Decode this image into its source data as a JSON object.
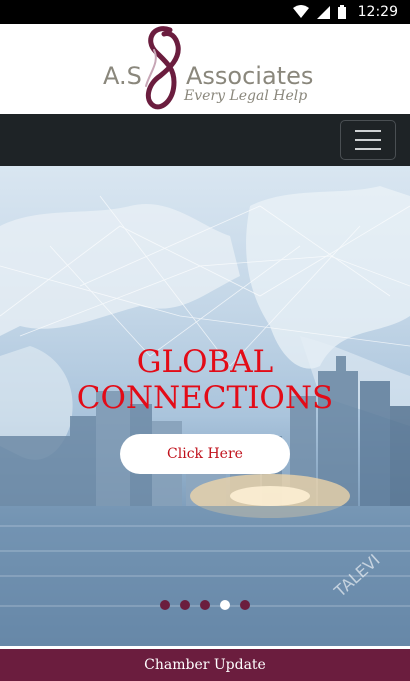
{
  "status_bar": {
    "time": "12:29",
    "icons": [
      "wifi-icon",
      "signal-icon",
      "battery-icon"
    ]
  },
  "header": {
    "logo_left": "A.S",
    "logo_right": "Associates",
    "logo_tagline": "Every Legal Help"
  },
  "navbar": {
    "toggle_icon": "hamburger-menu-icon"
  },
  "hero": {
    "title_line1": "GLOBAL",
    "title_line2": "CONNECTIONS",
    "button_label": "Click Here",
    "watermark": "TALEVI",
    "slides": [
      {
        "active": false
      },
      {
        "active": false
      },
      {
        "active": false
      },
      {
        "active": true
      },
      {
        "active": false
      }
    ]
  },
  "chamber_update": {
    "label": "Chamber Update"
  },
  "colors": {
    "brand_maroon": "#6b1d3e",
    "hero_title_red": "#e30b17",
    "navbar_dark": "#1e2326",
    "logo_grey": "#8a877c"
  }
}
